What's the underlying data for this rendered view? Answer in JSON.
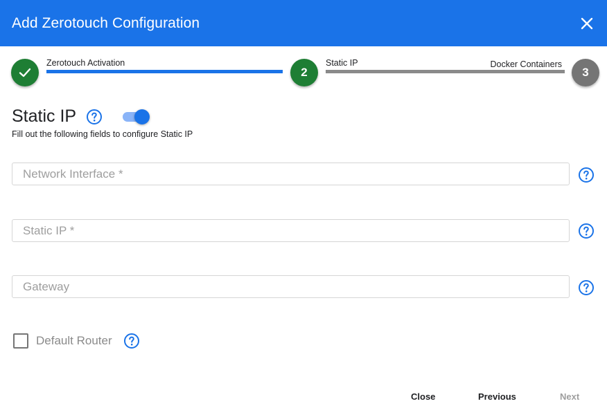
{
  "dialog": {
    "title": "Add Zerotouch Configuration"
  },
  "stepper": {
    "steps": [
      {
        "number": "",
        "label": "Zerotouch Activation",
        "state": "completed"
      },
      {
        "number": "2",
        "label": "Static IP",
        "state": "active"
      },
      {
        "number": "3",
        "label": "Docker Containers",
        "state": "pending"
      }
    ]
  },
  "section": {
    "title": "Static IP",
    "toggle_on": true,
    "description": "Fill out the following fields to configure Static IP"
  },
  "fields": {
    "network_interface": {
      "placeholder": "Network Interface *",
      "value": ""
    },
    "static_ip": {
      "placeholder": "Static IP *",
      "value": ""
    },
    "gateway": {
      "placeholder": "Gateway",
      "value": ""
    }
  },
  "checkbox": {
    "label": "Default Router",
    "checked": false
  },
  "footer": {
    "close_label": "Close",
    "previous_label": "Previous",
    "next_label": "Next"
  },
  "colors": {
    "primary": "#1a73e8",
    "success": "#1e7e34",
    "pending": "#757575",
    "disabled_text": "#9e9e9e"
  },
  "icons": {
    "close": "close-icon",
    "check": "check-icon",
    "help": "help-circle-icon"
  }
}
